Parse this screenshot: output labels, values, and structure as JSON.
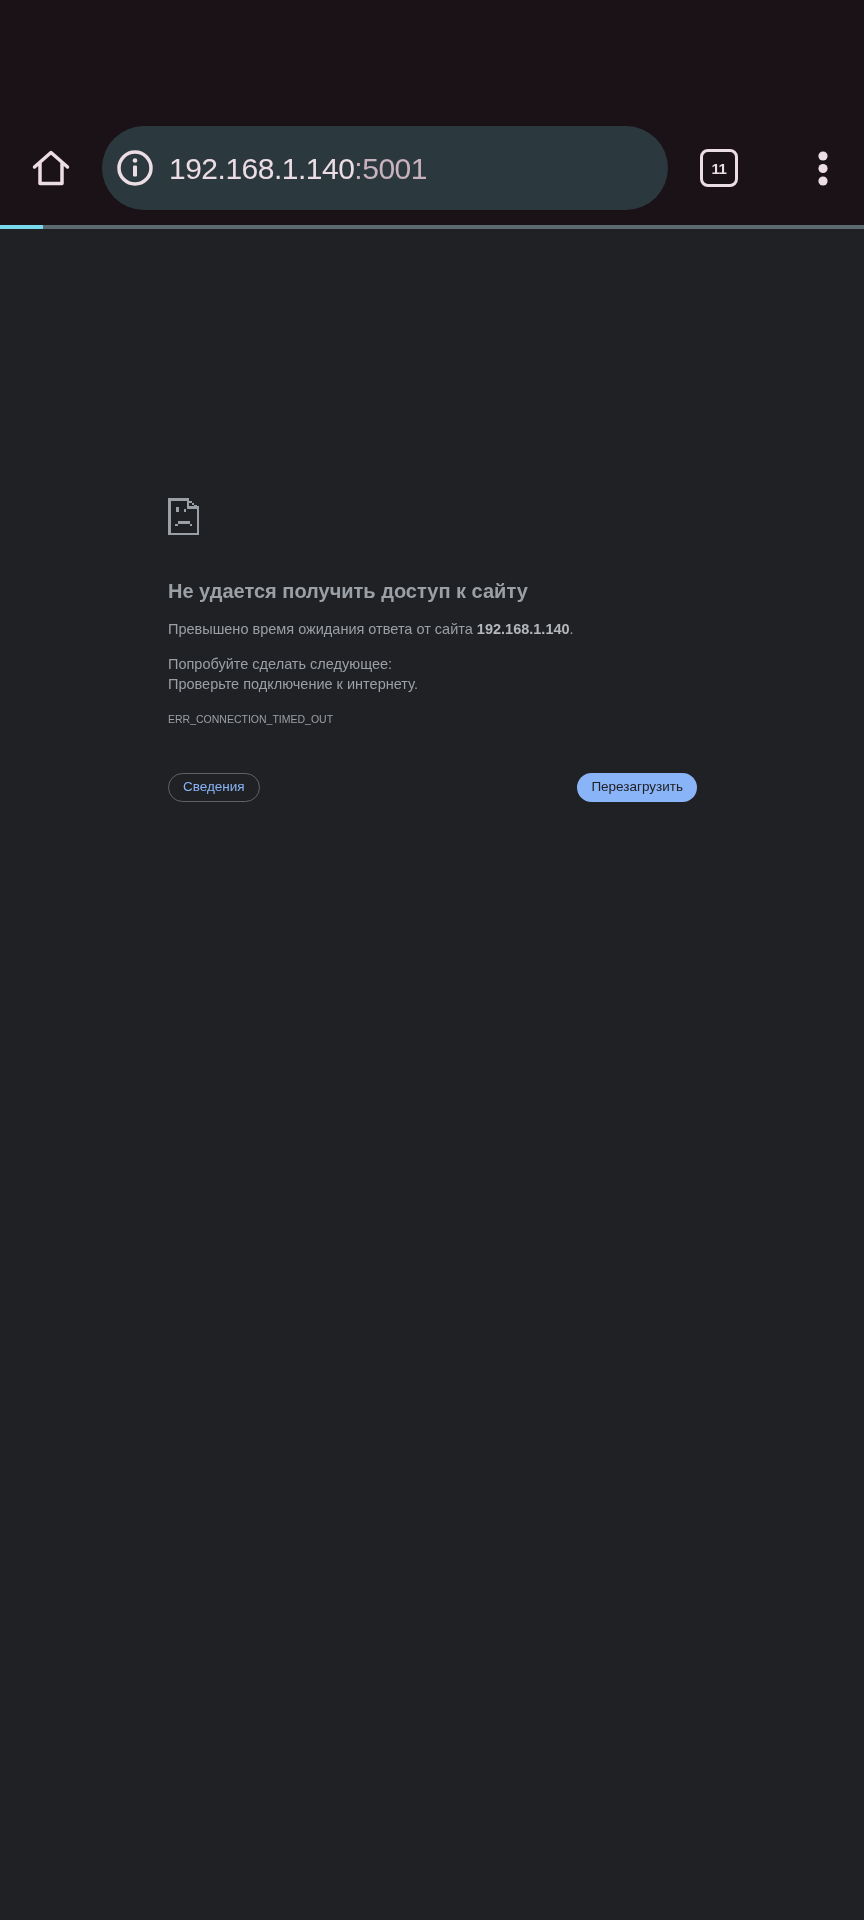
{
  "toolbar": {
    "url": {
      "host": "192.168.1.140",
      "port": ":5001"
    },
    "tab_count": "11"
  },
  "progress": {
    "level": 0.05
  },
  "error": {
    "title": "Не удается получить доступ к сайту",
    "message": "Превышено время ожидания ответа от сайта **192.168.1.140**.",
    "suggestions_heading": "Попробуйте сделать следующее:",
    "suggestions": [
      "Проверьте подключение к интернету."
    ],
    "code": "ERR_CONNECTION_TIMED_OUT"
  },
  "buttons": [
    {
      "label": "Сведения",
      "kind": "secondary"
    },
    {
      "label": "Перезагрузить",
      "kind": "primary"
    }
  ]
}
